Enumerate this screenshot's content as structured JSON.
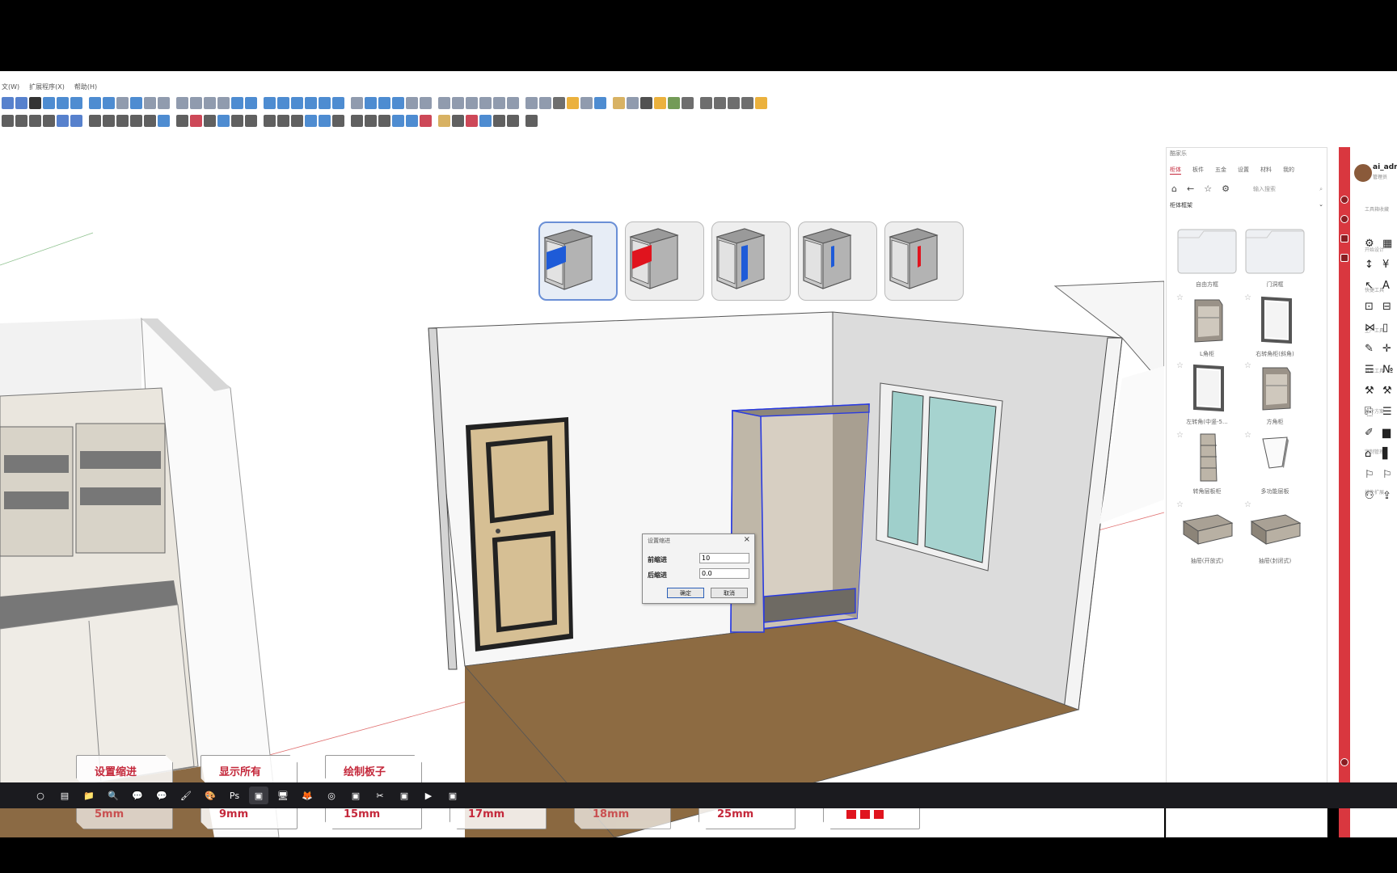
{
  "menubar": {
    "items": [
      "文(W)",
      "扩展程序(X)",
      "帮助(H)"
    ]
  },
  "toolbar": {
    "row1_colors": [
      "#3a6bc4",
      "#3a6bc4",
      "#111111",
      "#2f78c9",
      "#2f78c9",
      "#2f78c9",
      "#2f78c9",
      "#2f78c9",
      "#7c8aa0",
      "#2f78c9",
      "#7c8aa0",
      "#7c8aa0",
      "#7c8aa0",
      "#7c8aa0",
      "#7c8aa0",
      "#7c8aa0",
      "#2f78c9",
      "#2f78c9",
      "#2f78c9",
      "#2f78c9",
      "#2f78c9",
      "#2f78c9",
      "#2f78c9",
      "#2f78c9",
      "#7c8aa0",
      "#2f78c9",
      "#2f78c9",
      "#2f78c9",
      "#7c8aa0",
      "#7c8aa0",
      "#7c8aa0",
      "#7c8aa0",
      "#7c8aa0",
      "#7c8aa0",
      "#7c8aa0",
      "#7c8aa0",
      "#7c8aa0",
      "#7c8aa0",
      "#555555",
      "#e8a31b",
      "#7c8aa0",
      "#2f78c9",
      "#d1a548",
      "#7c8aa0",
      "#333333",
      "#e8a31b",
      "#5a8a3a",
      "#555555",
      "#555555",
      "#555555",
      "#555555",
      "#555555",
      "#e8a31b"
    ],
    "row2_colors": [
      "#444444",
      "#444444",
      "#444444",
      "#444444",
      "#3a6bc4",
      "#3a6bc4",
      "#444444",
      "#444444",
      "#444444",
      "#444444",
      "#444444",
      "#2f78c9",
      "#444444",
      "#c4283b",
      "#444444",
      "#2f78c9",
      "#444444",
      "#444444",
      "#444444",
      "#444444",
      "#444444",
      "#2f78c9",
      "#2f78c9",
      "#444444",
      "#444444",
      "#444444",
      "#444444",
      "#2f78c9",
      "#2f78c9",
      "#c4283b",
      "#d1a548",
      "#444444",
      "#c4283b",
      "#2f78c9",
      "#444444",
      "#444444",
      "#444444"
    ]
  },
  "presets": [
    {
      "name": "preset-front-blue",
      "color": "#1e5bd8",
      "shape": "front"
    },
    {
      "name": "preset-front-red",
      "color": "#e0141e",
      "shape": "front"
    },
    {
      "name": "preset-side-blue",
      "color": "#1e5bd8",
      "shape": "side"
    },
    {
      "name": "preset-edge-blue",
      "color": "#1e5bd8",
      "shape": "edge"
    },
    {
      "name": "preset-edge-red",
      "color": "#e0141e",
      "shape": "edge"
    }
  ],
  "dialog": {
    "title": "设置缩进",
    "front_label": "前缩进",
    "front_value": "10",
    "back_label": "后缩进",
    "back_value": "0.0",
    "ok": "确定",
    "cancel": "取消"
  },
  "hud": {
    "row1": [
      "设置缩进",
      "显示所有",
      "绘制板子"
    ],
    "row2": [
      "5mm",
      "9mm",
      "15mm",
      "17mm",
      "18mm",
      "25mm"
    ]
  },
  "panel": {
    "title": "酷家乐",
    "tabs": [
      "柜体",
      "板件",
      "五金",
      "设置",
      "材料",
      "我的"
    ],
    "search_placeholder": "输入搜索",
    "category": "柜体框架",
    "items": [
      {
        "caption": "自由方框",
        "kind": "folder"
      },
      {
        "caption": "门洞框",
        "kind": "folder"
      },
      {
        "caption": "L角柜",
        "kind": "corner"
      },
      {
        "caption": "右转角柜(斜角)",
        "kind": "frame"
      },
      {
        "caption": "左转角(中竖-5...",
        "kind": "frame"
      },
      {
        "caption": "方角柜",
        "kind": "corner"
      },
      {
        "caption": "转角层板柜",
        "kind": "shelf"
      },
      {
        "caption": "多功能层板",
        "kind": "panel"
      },
      {
        "caption": "抽屉(开放式)",
        "kind": "drawer"
      },
      {
        "caption": "抽屉(封闭式)",
        "kind": "drawer"
      }
    ]
  },
  "right_panel": {
    "user": "ai_admin",
    "role": "管理员",
    "labels": [
      "工具箱收藏",
      "开始设计",
      "快捷工具",
      "生产工具",
      "拆单工具",
      "设计方案",
      "定制管理",
      "插件扩展"
    ],
    "icons": [
      "⚙",
      "▦",
      "↕",
      "¥",
      "↖",
      "A",
      "⊡",
      "⊟",
      "⋈",
      "▯",
      "✎",
      "✛",
      "☰",
      "№",
      "⚒",
      "⚒",
      "⎘",
      "☰",
      "✐",
      "▆",
      "⌂",
      "▋",
      "⚐",
      "⚐",
      "⚇",
      "⇪"
    ]
  },
  "taskbar": {
    "apps": [
      "○",
      "▤",
      "📁",
      "🔍",
      "💬",
      "💬",
      "🖌",
      "🎨",
      "Ps",
      "▣",
      "🖥",
      "🦊",
      "◎",
      "▣",
      "✂",
      "▣",
      "▶",
      "▣"
    ]
  }
}
